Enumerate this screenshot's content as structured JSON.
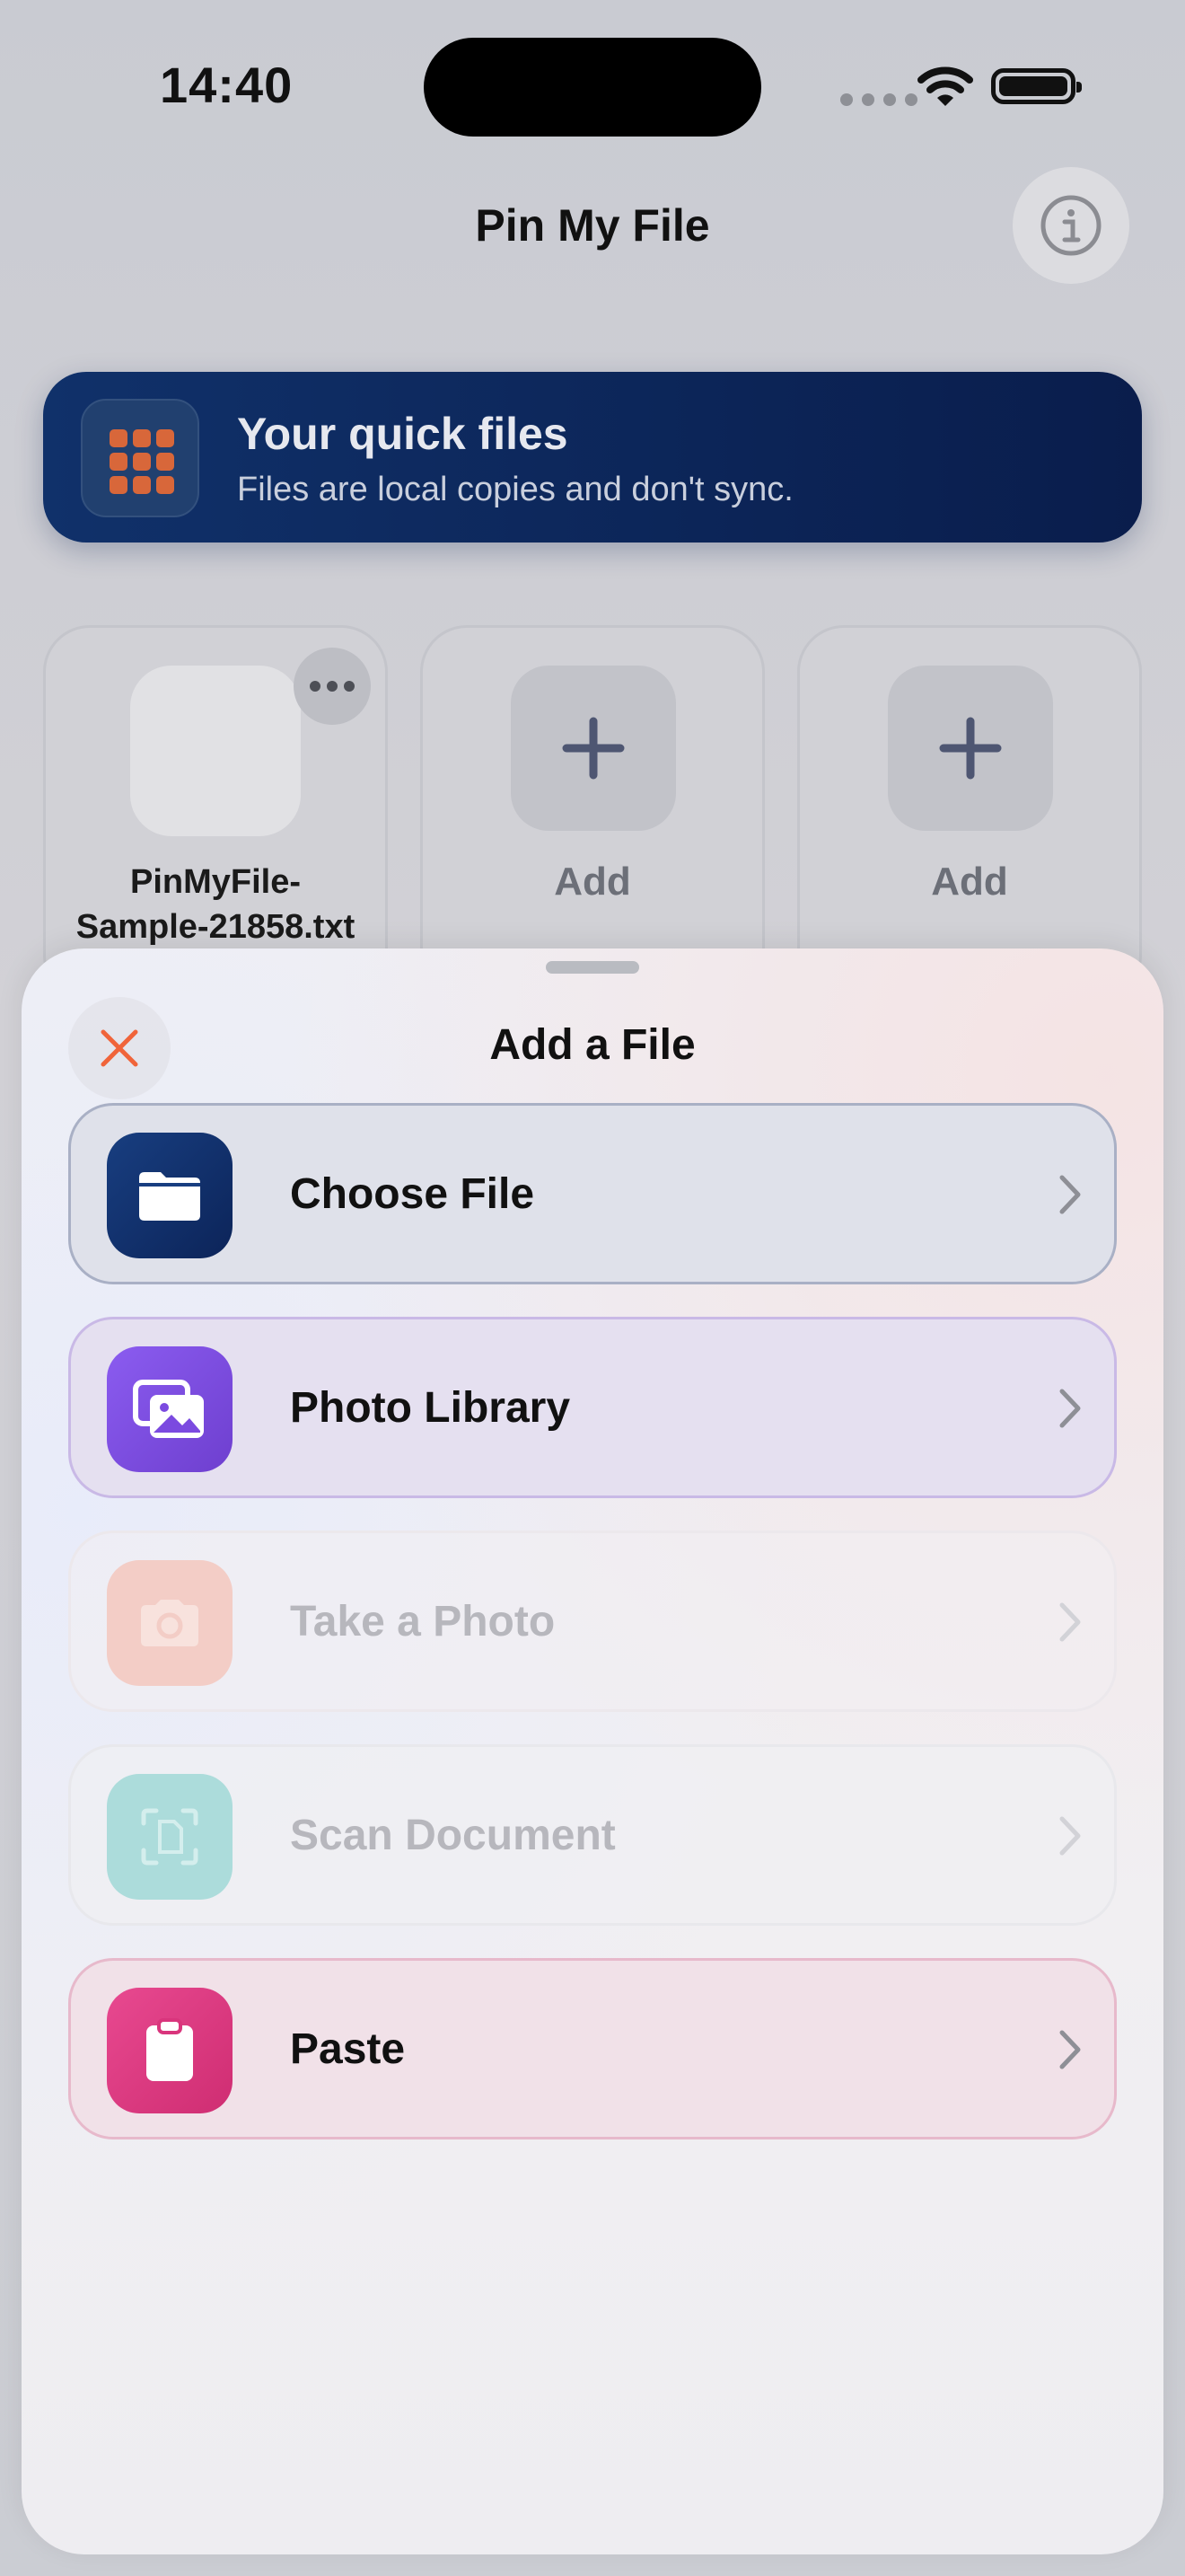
{
  "status_bar": {
    "time": "14:40"
  },
  "nav": {
    "title": "Pin My File",
    "info_icon": "info-icon"
  },
  "banner": {
    "title": "Your quick files",
    "subtitle": "Files are local copies and don't sync.",
    "icon": "grid-icon",
    "icon_color": "#d8673a"
  },
  "tiles": [
    {
      "file_name_line1": "PinMyFile-",
      "file_name_line2": "Sample-21858.txt"
    },
    {
      "label": "Add"
    },
    {
      "label": "Add"
    }
  ],
  "sheet": {
    "title": "Add a File",
    "options": [
      {
        "label": "Choose File",
        "icon": "folder-icon",
        "enabled": true,
        "color": "#0c2459"
      },
      {
        "label": "Photo Library",
        "icon": "photos-icon",
        "enabled": true,
        "color": "#7b4ae0"
      },
      {
        "label": "Take a Photo",
        "icon": "camera-icon",
        "enabled": false,
        "color": "#f3cdc6"
      },
      {
        "label": "Scan Document",
        "icon": "scan-icon",
        "enabled": false,
        "color": "#acdcdb"
      },
      {
        "label": "Paste",
        "icon": "clipboard-icon",
        "enabled": true,
        "color": "#d9357c"
      }
    ]
  },
  "colors": {
    "close_accent": "#f0643a",
    "banner_bg": "#0c2558"
  }
}
